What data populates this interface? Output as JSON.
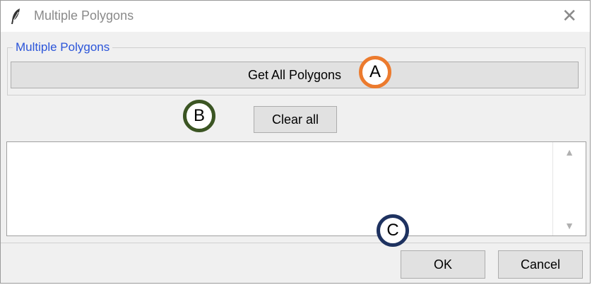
{
  "window": {
    "title": "Multiple Polygons",
    "close_glyph": "✕"
  },
  "group": {
    "label": "Multiple Polygons",
    "get_all_label": "Get All Polygons"
  },
  "clear_all_label": "Clear all",
  "textarea": {
    "value": ""
  },
  "scroll": {
    "up_glyph": "▲",
    "down_glyph": "▼"
  },
  "footer": {
    "ok_label": "OK",
    "cancel_label": "Cancel"
  },
  "callouts": {
    "a": "A",
    "b": "B",
    "c": "C"
  },
  "colors": {
    "group_label": "#2b55d9",
    "callout_a": "#ec7b2e",
    "callout_b": "#3b5523",
    "callout_c": "#1e3260"
  }
}
